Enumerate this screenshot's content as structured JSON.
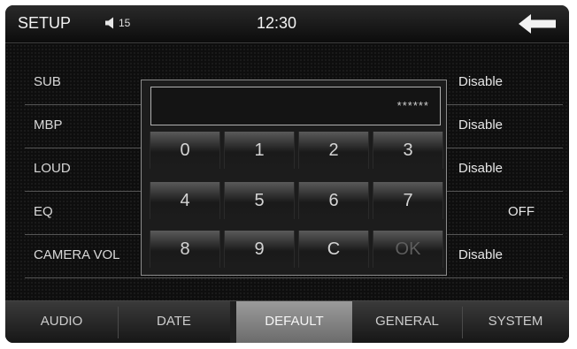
{
  "header": {
    "title": "SETUP",
    "volume": "15",
    "time": "12:30",
    "volume_icon": "speaker-icon",
    "back_icon": "back-arrow-icon"
  },
  "rows": [
    {
      "label": "SUB",
      "value": "Disable"
    },
    {
      "label": "MBP",
      "value": "Disable"
    },
    {
      "label": "LOUD",
      "value": "Disable"
    },
    {
      "label": "EQ",
      "value": "OFF"
    },
    {
      "label": "CAMERA VOL",
      "value": "Disable"
    }
  ],
  "keypad": {
    "password": "******",
    "keys": [
      "0",
      "1",
      "2",
      "3",
      "4",
      "5",
      "6",
      "7",
      "8",
      "9",
      "C",
      "OK"
    ]
  },
  "tabs": [
    {
      "label": "AUDIO"
    },
    {
      "label": "DATE"
    },
    {
      "label": "DEFAULT",
      "active": true
    },
    {
      "label": "GENERAL"
    },
    {
      "label": "SYSTEM"
    }
  ],
  "colors": {
    "background": "#0e0e0e",
    "active_tab": "#8a8a8a",
    "text": "#e6e6e6"
  }
}
